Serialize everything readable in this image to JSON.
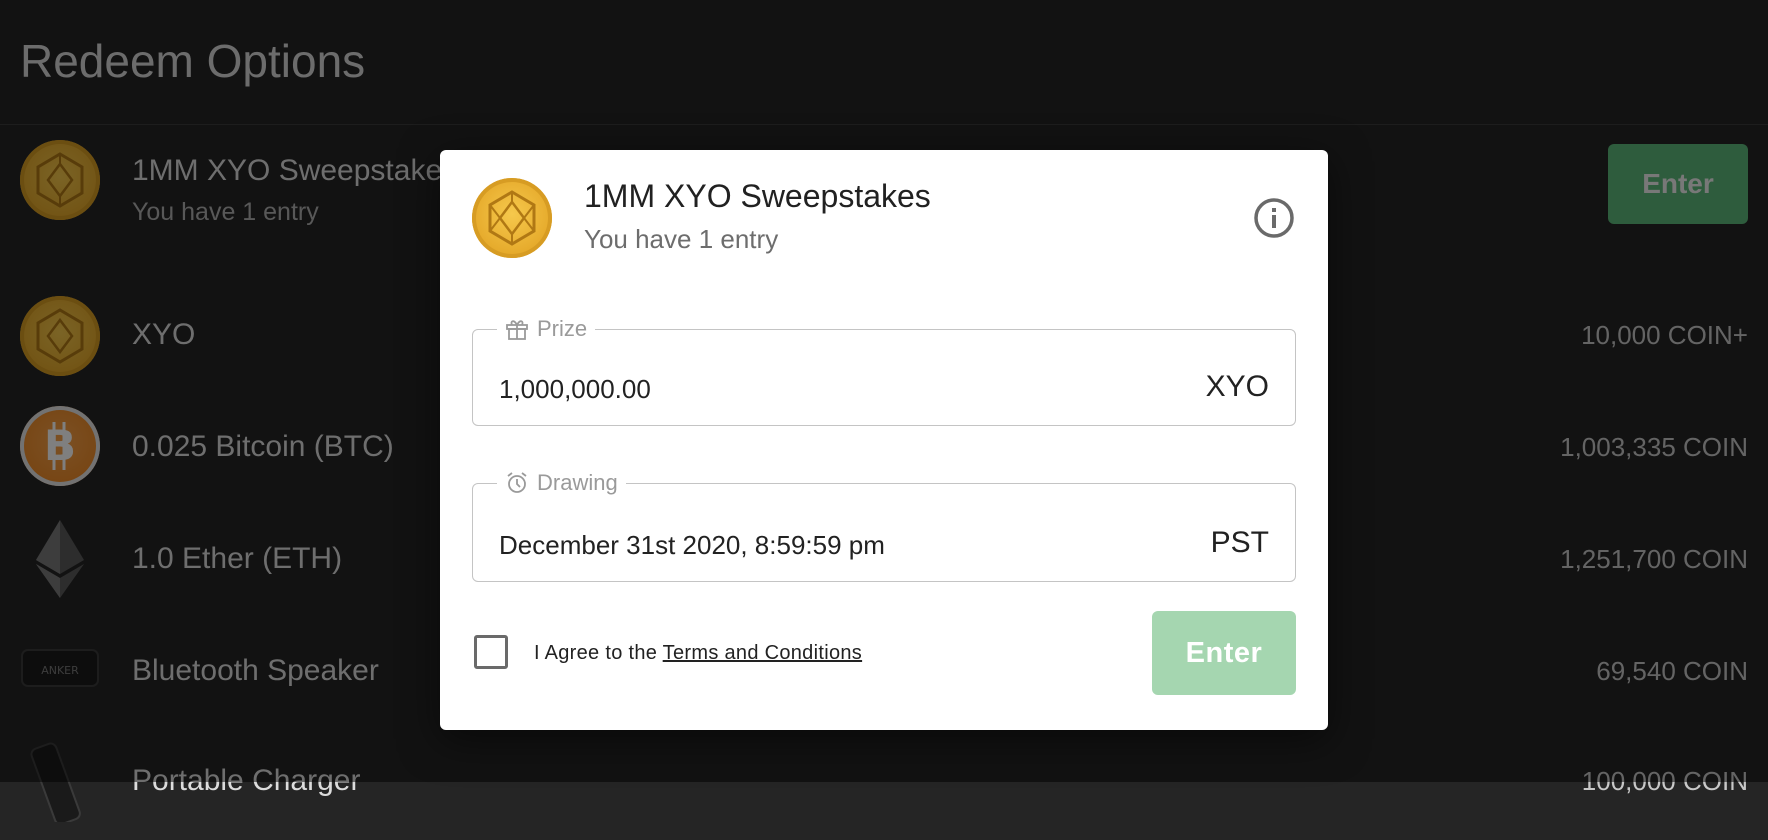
{
  "page": {
    "title": "Redeem Options"
  },
  "list": {
    "items": [
      {
        "title": "1MM XYO Sweepstakes",
        "subtitle": "You have 1 entry",
        "action_label": "Enter",
        "icon": "xyo-coin-icon"
      },
      {
        "title": "XYO",
        "price": "10,000 COIN+",
        "icon": "xyo-coin-icon"
      },
      {
        "title": "0.025 Bitcoin (BTC)",
        "price": "1,003,335 COIN",
        "icon": "bitcoin-icon"
      },
      {
        "title": "1.0 Ether (ETH)",
        "price": "1,251,700 COIN",
        "icon": "ethereum-icon"
      },
      {
        "title": "Bluetooth Speaker",
        "price": "69,540 COIN",
        "icon": "speaker-icon",
        "brand": "ANKER"
      },
      {
        "title": "Portable Charger",
        "price": "100,000 COIN",
        "icon": "charger-icon"
      }
    ]
  },
  "modal": {
    "title": "1MM XYO Sweepstakes",
    "subtitle": "You have 1 entry",
    "info_icon": "info-icon",
    "prize": {
      "label": "Prize",
      "value": "1,000,000.00",
      "unit": "XYO",
      "icon": "gift-icon"
    },
    "drawing": {
      "label": "Drawing",
      "value": "December 31st 2020, 8:59:59 pm",
      "unit": "PST",
      "icon": "alarm-clock-icon"
    },
    "agree": {
      "prefix": "I Agree to the ",
      "link": "Terms and Conditions",
      "checked": false
    },
    "enter_label": "Enter"
  },
  "colors": {
    "background": "#252525",
    "accent_green": "#5cb87a",
    "disabled_green": "#a5d6b0",
    "gold": "#e5a92a",
    "bitcoin_orange": "#ee8a26"
  }
}
